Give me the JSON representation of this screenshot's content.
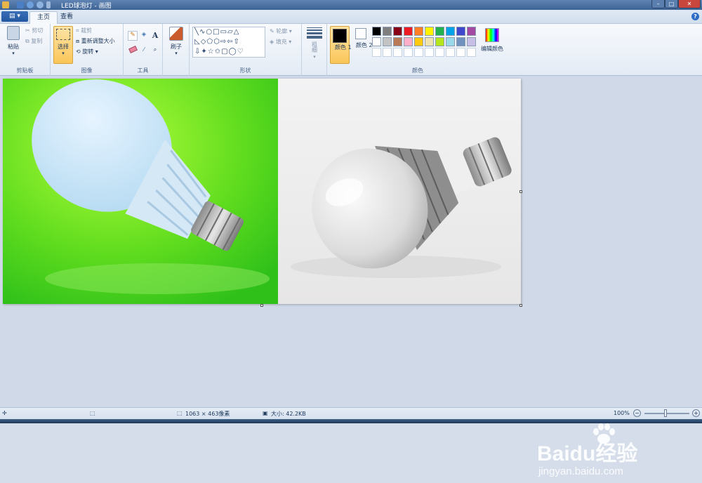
{
  "window": {
    "title": "LED球泡灯 - 画图",
    "controls": [
      "minimize",
      "maximize",
      "close"
    ]
  },
  "tabs": [
    {
      "label": "主页",
      "active": true
    },
    {
      "label": "查看",
      "active": false
    }
  ],
  "ribbon": {
    "clipboard": {
      "paste_label": "粘贴",
      "cut_label": "剪切",
      "copy_label": "复制",
      "group_label": "剪贴板"
    },
    "image": {
      "select_label": "选择",
      "crop_label": "裁剪",
      "resize_label": "重新调整大小",
      "rotate_label": "旋转",
      "group_label": "图像"
    },
    "tools": {
      "group_label": "工具"
    },
    "brushes": {
      "label": "刷子"
    },
    "shapes": {
      "outline_label": "轮廓",
      "fill_label": "填充",
      "group_label": "形状"
    },
    "size": {
      "label": "粗细"
    },
    "colors": {
      "color1_label": "颜色 1",
      "color2_label": "颜色 2",
      "edit_label": "编辑颜色",
      "group_label": "颜色",
      "color1": "#000000",
      "color2": "#ffffff",
      "palette_row1": [
        "#000000",
        "#7f7f7f",
        "#880015",
        "#ed1c24",
        "#ff7f27",
        "#fff200",
        "#22b14c",
        "#00a2e8",
        "#3f48cc",
        "#a349a4"
      ],
      "palette_row2": [
        "#ffffff",
        "#c3c3c3",
        "#b97a57",
        "#ffaec9",
        "#ffc90e",
        "#efe4b0",
        "#b5e61d",
        "#99d9ea",
        "#7092be",
        "#c8bfe7"
      ]
    }
  },
  "status": {
    "dimensions": "1063 × 463像素",
    "size": "大小: 42.2KB",
    "zoom": "100%"
  },
  "watermark": {
    "brand": "Baidu经验",
    "url": "jingyan.baidu.com"
  }
}
